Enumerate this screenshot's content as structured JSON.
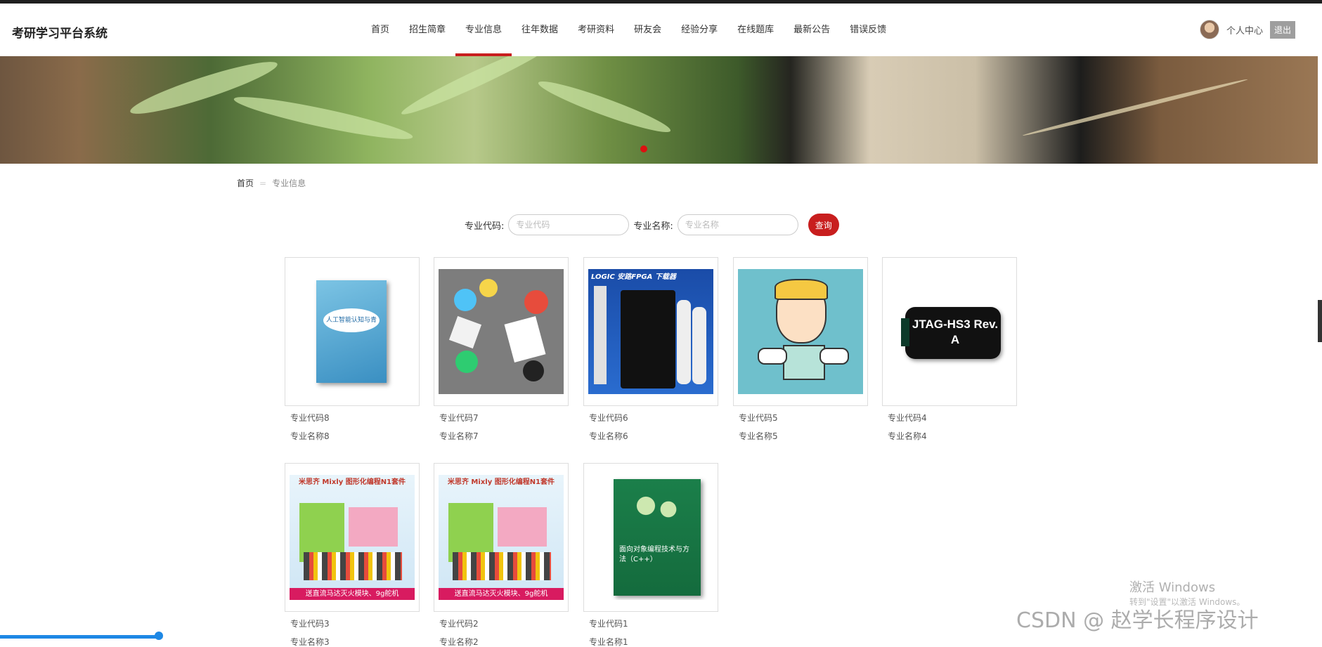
{
  "header": {
    "site_title": "考研学习平台系统",
    "nav": [
      "首页",
      "招生简章",
      "专业信息",
      "往年数据",
      "考研资料",
      "研友会",
      "经验分享",
      "在线题库",
      "最新公告",
      "错误反馈"
    ],
    "active_index": 2,
    "user_center": "个人中心",
    "logout": "退出"
  },
  "breadcrumb": {
    "home": "首页",
    "separator": "=",
    "current": "专业信息"
  },
  "search": {
    "code_label": "专业代码:",
    "code_placeholder": "专业代码",
    "name_label": "专业名称:",
    "name_placeholder": "专业名称",
    "button": "查询"
  },
  "items": [
    {
      "code": "专业代码8",
      "name": "专业名称8",
      "image": "blue-book-cover",
      "image_text": "人工智能认知与青少年编程"
    },
    {
      "code": "专业代码7",
      "name": "专业名称7",
      "image": "flat-illustration-hands"
    },
    {
      "code": "专业代码6",
      "name": "专业名称6",
      "image": "fpga-downloader",
      "image_text": "LOGIC 安路FPGA 下载器"
    },
    {
      "code": "专业代码5",
      "name": "专业名称5",
      "image": "cartoon-man-puzzle"
    },
    {
      "code": "专业代码4",
      "name": "专业名称4",
      "image": "jtag-device",
      "image_text": "JTAG-HS3 Rev. A"
    },
    {
      "code": "专业代码3",
      "name": "专业名称3",
      "image": "mixly-kit",
      "image_text": "米思齐 Mixly 图形化编程N1套件",
      "image_banner": "送直流马达灭火模块、9g舵机"
    },
    {
      "code": "专业代码2",
      "name": "专业名称2",
      "image": "mixly-kit",
      "image_text": "米思齐 Mixly 图形化编程N1套件",
      "image_banner": "送直流马达灭火模块、9g舵机"
    },
    {
      "code": "专业代码1",
      "name": "专业名称1",
      "image": "green-book-cover",
      "image_text": "面向对象编程技术与方法（C++）"
    }
  ],
  "watermarks": {
    "windows_title": "激活 Windows",
    "windows_sub": "转到\"设置\"以激活 Windows。",
    "csdn": "CSDN @ 赵学长程序设计"
  },
  "colors": {
    "accent": "#c81e1e",
    "progress": "#1e88e5"
  },
  "video_progress": 0.12
}
